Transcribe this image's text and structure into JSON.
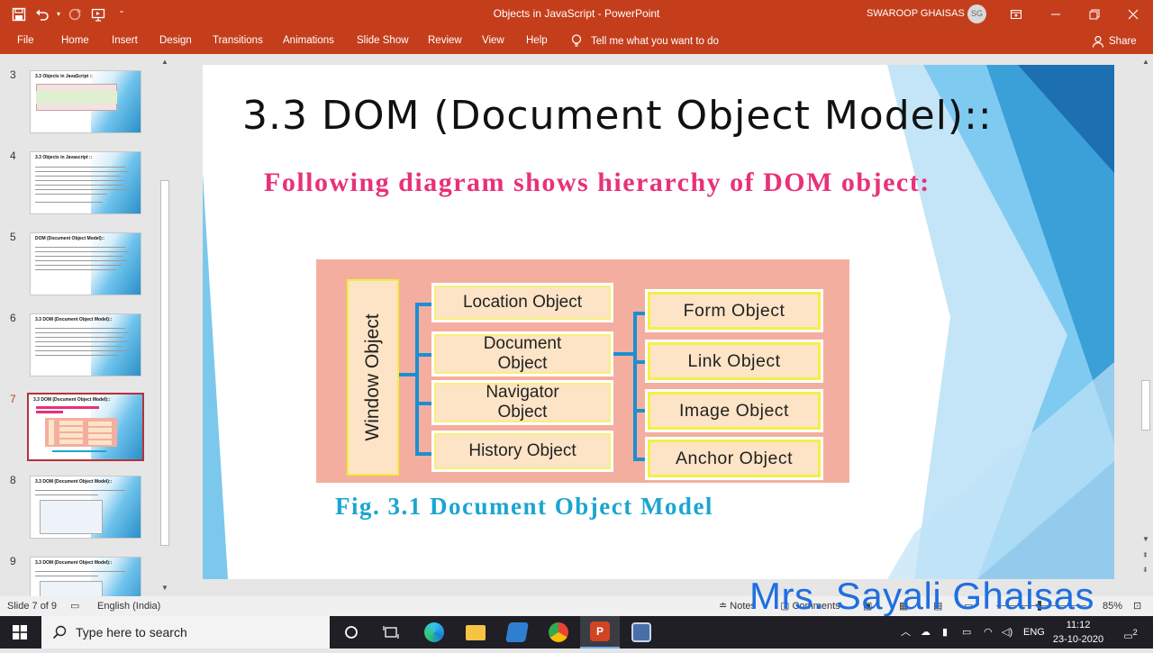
{
  "window": {
    "title": "Objects in JavaScript  -  PowerPoint",
    "user_name": "SWAROOP GHAISAS",
    "user_initials": "SG"
  },
  "ribbon": {
    "tabs": [
      "File",
      "Home",
      "Insert",
      "Design",
      "Transitions",
      "Animations",
      "Slide Show",
      "Review",
      "View",
      "Help"
    ],
    "tell_me": "Tell me what you want to do",
    "share": "Share"
  },
  "thumbnails": [
    {
      "num": "3",
      "title": "3.3 Objects in JavaScript ::"
    },
    {
      "num": "4",
      "title": "3.3 Objects in Javascript ::"
    },
    {
      "num": "5",
      "title": "DOM (Document Object Model)::"
    },
    {
      "num": "6",
      "title": "3.3 DOM (Document Object Model)::"
    },
    {
      "num": "7",
      "title": "3.3 DOM (Document Object Model)::"
    },
    {
      "num": "8",
      "title": "3.3 DOM (Document Object Model)::"
    },
    {
      "num": "9",
      "title": "3.3 DOM (Document Object Model)::"
    }
  ],
  "slide": {
    "title": "3.3 DOM (Document Object Model)::",
    "subtitle": "Following diagram shows hierarchy of DOM object:",
    "diagram": {
      "root": "Window Object",
      "level1": [
        {
          "line1": "Location Object",
          "line2": ""
        },
        {
          "line1": "Document",
          "line2": "Object"
        },
        {
          "line1": "Navigator",
          "line2": "Object"
        },
        {
          "line1": "History Object",
          "line2": ""
        }
      ],
      "level2": [
        "Form Object",
        "Link Object",
        "Image Object",
        "Anchor Object"
      ]
    },
    "caption": "Fig. 3.1 Document Object Model"
  },
  "status": {
    "slide_info": "Slide 7 of 9",
    "language": "English (India)",
    "notes": "Notes",
    "comments": "Comments",
    "zoom": "85%"
  },
  "watermark": "Mrs. Sayali Ghaisas",
  "taskbar": {
    "search_placeholder": "Type here to search",
    "lang": "ENG",
    "time": "11:12",
    "date": "23-10-2020",
    "notifications": "2"
  },
  "colors": {
    "accent": "#c43e1c",
    "subtitle": "#e8317a",
    "caption": "#1ba6d0",
    "diagram_bg": "#f4aea0",
    "box_fill": "#fde4c6",
    "connector": "#1c8fd0"
  }
}
